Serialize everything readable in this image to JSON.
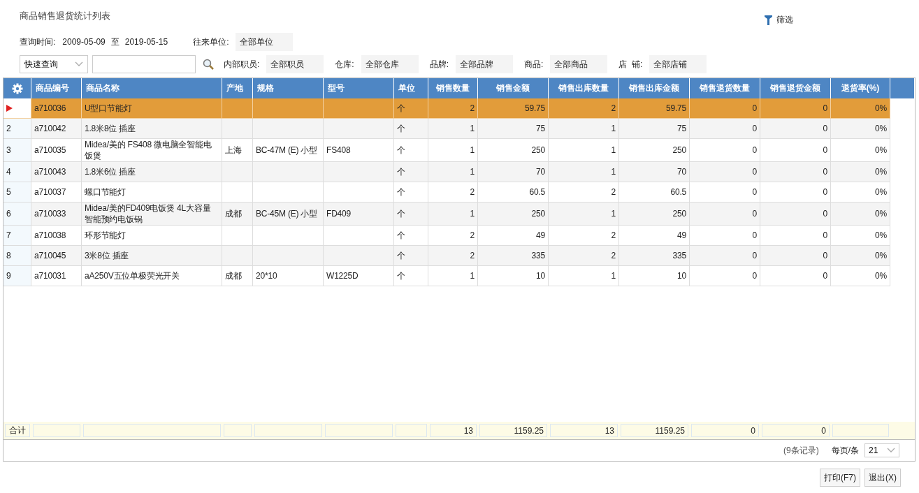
{
  "title": "商品销售退货统计列表",
  "filter_button": {
    "label": "筛选"
  },
  "query_time": {
    "label": "查询时间:",
    "from": "2009-05-09",
    "separator": "至",
    "to": "2019-05-15"
  },
  "partner": {
    "label": "往来单位:",
    "value": "全部单位"
  },
  "quick_search": {
    "value": "快速查询"
  },
  "filters": [
    {
      "label": "内部职员:",
      "value": "全部职员"
    },
    {
      "label": "仓库:",
      "value": "全部仓库"
    },
    {
      "label": "品牌:",
      "value": "全部品牌"
    },
    {
      "label": "商品:",
      "value": "全部商品"
    },
    {
      "label": "店  铺:",
      "value": "全部店铺"
    }
  ],
  "table": {
    "columns": [
      "商品编号",
      "商品名称",
      "产地",
      "规格",
      "型号",
      "单位",
      "销售数量",
      "销售金额",
      "销售出库数量",
      "销售出库金额",
      "销售退货数量",
      "销售退货金额",
      "退货率(%)"
    ],
    "rows": [
      {
        "selected": true,
        "cells": [
          "a710036",
          "U型口节能灯",
          "",
          "",
          "",
          "个",
          "2",
          "59.75",
          "2",
          "59.75",
          "0",
          "0",
          "0%"
        ]
      },
      {
        "no": "2",
        "selected": false,
        "cells": [
          "a710042",
          "1.8米8位 插座",
          "",
          "",
          "",
          "个",
          "1",
          "75",
          "1",
          "75",
          "0",
          "0",
          "0%"
        ]
      },
      {
        "no": "3",
        "selected": false,
        "cells": [
          "a710035",
          "Midea/美的 FS408 微电脑全智能电饭煲",
          "上海",
          "BC-47M (E) 小型",
          "FS408",
          "个",
          "1",
          "250",
          "1",
          "250",
          "0",
          "0",
          "0%"
        ]
      },
      {
        "no": "4",
        "selected": false,
        "cells": [
          "a710043",
          "1.8米6位 插座",
          "",
          "",
          "",
          "个",
          "1",
          "70",
          "1",
          "70",
          "0",
          "0",
          "0%"
        ]
      },
      {
        "no": "5",
        "selected": false,
        "cells": [
          "a710037",
          "螺口节能灯",
          "",
          "",
          "",
          "个",
          "2",
          "60.5",
          "2",
          "60.5",
          "0",
          "0",
          "0%"
        ]
      },
      {
        "no": "6",
        "selected": false,
        "cells": [
          "a710033",
          "Midea/美的FD409电饭煲 4L大容量智能预约电饭锅",
          "成都",
          "BC-45M (E) 小型",
          "FD409",
          "个",
          "1",
          "250",
          "1",
          "250",
          "0",
          "0",
          "0%"
        ]
      },
      {
        "no": "7",
        "selected": false,
        "cells": [
          "a710038",
          "环形节能灯",
          "",
          "",
          "",
          "个",
          "2",
          "49",
          "2",
          "49",
          "0",
          "0",
          "0%"
        ]
      },
      {
        "no": "8",
        "selected": false,
        "cells": [
          "a710045",
          "3米8位 插座",
          "",
          "",
          "",
          "个",
          "2",
          "335",
          "2",
          "335",
          "0",
          "0",
          "0%"
        ]
      },
      {
        "no": "9",
        "selected": false,
        "cells": [
          "a710031",
          "aA250V五位单极荧光开关",
          "成都",
          "20*10",
          "W1225D",
          "个",
          "1",
          "10",
          "1",
          "10",
          "0",
          "0",
          "0%"
        ]
      }
    ],
    "totals_label": "合计",
    "totals": {
      "sales_qty": "13",
      "sales_amount": "1159.25",
      "outbound_qty": "13",
      "outbound_amount": "1159.25",
      "return_qty": "0",
      "return_amount": "0"
    }
  },
  "pagination": {
    "records": "(9条记录)",
    "per_page_label": "每页/条",
    "per_page": "21"
  },
  "buttons": [
    "打印(F7)",
    "退出(X)"
  ]
}
